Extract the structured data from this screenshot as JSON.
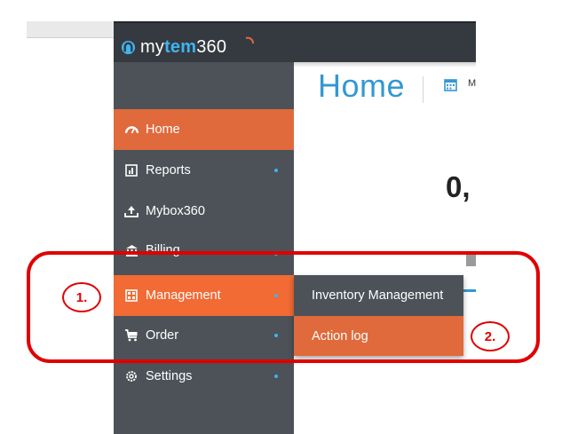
{
  "brand": {
    "logo_prefix": "my",
    "logo_mid": "tem",
    "logo_suffix": "360"
  },
  "header": {
    "page_title": "Home",
    "date_label": "M"
  },
  "content": {
    "big_number": "0,"
  },
  "sidebar": {
    "items": [
      {
        "label": "Home",
        "icon": "speedometer-icon",
        "active": true
      },
      {
        "label": "Reports",
        "icon": "report-chart-icon",
        "has_submenu": true
      },
      {
        "label": "Mybox360",
        "icon": "upload-tray-icon"
      },
      {
        "label": "Billing",
        "icon": "bank-icon",
        "has_submenu": true
      },
      {
        "label": "Management",
        "icon": "management-grid-icon",
        "active": true,
        "has_submenu": true
      },
      {
        "label": "Order",
        "icon": "cart-icon",
        "has_submenu": true
      },
      {
        "label": "Settings",
        "icon": "gear-icon",
        "has_submenu": true
      }
    ]
  },
  "submenu": {
    "items": [
      {
        "label": "Inventory Management"
      },
      {
        "label": "Action log",
        "highlighted": true
      }
    ]
  },
  "annotations": {
    "callout_1": "1.",
    "callout_2": "2."
  },
  "colors": {
    "sidebar_bg": "#4c5258",
    "topbar_bg": "#353a40",
    "accent_orange": "#e06a3b",
    "accent_orange_bright": "#f26a34",
    "title_blue": "#3398d1",
    "annotation_red": "#e00000"
  }
}
